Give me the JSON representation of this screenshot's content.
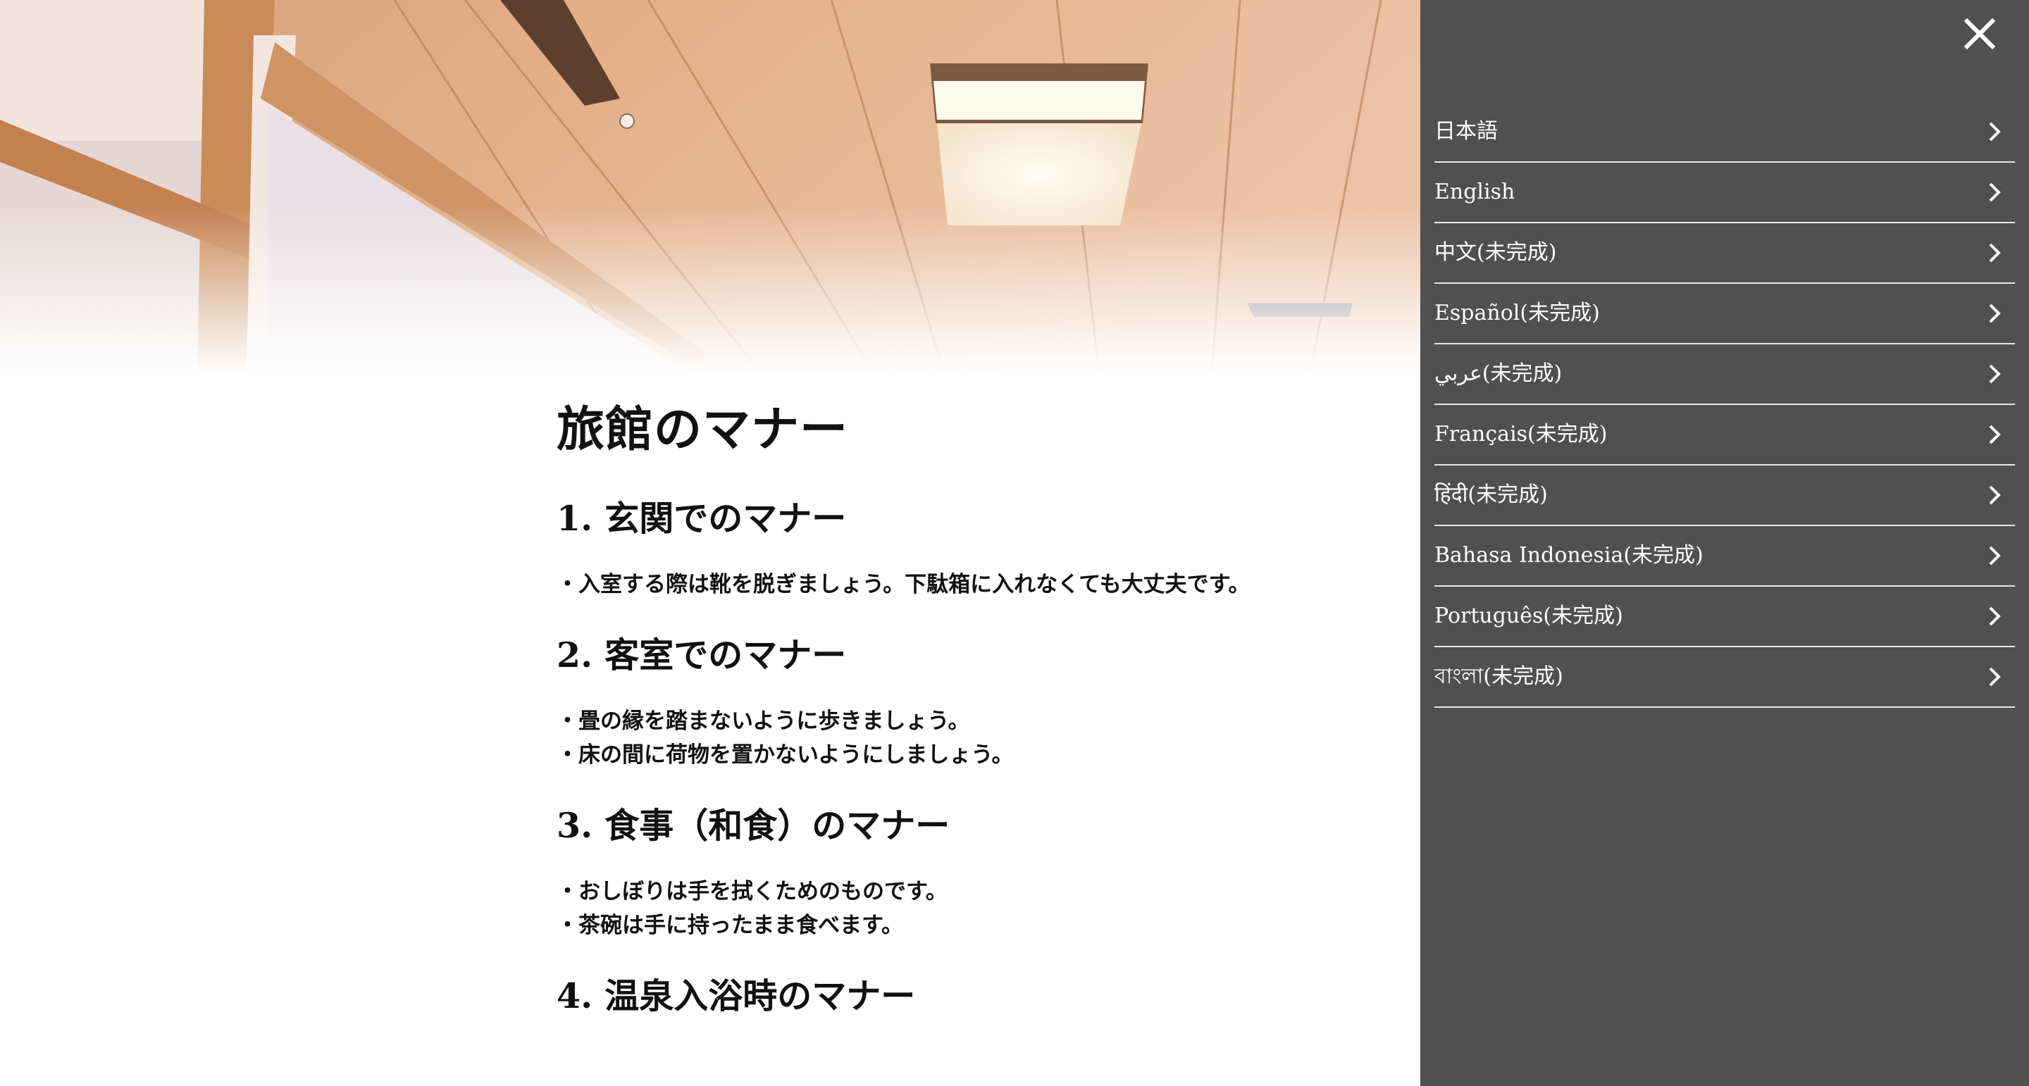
{
  "article": {
    "title": "旅館のマナー",
    "sections": [
      {
        "heading": "1. 玄関でのマナー",
        "items": [
          "・入室する際は靴を脱ぎましょう。下駄箱に入れなくても大丈夫です。"
        ]
      },
      {
        "heading": "2. 客室でのマナー",
        "items": [
          "・畳の縁を踏まないように歩きましょう。",
          "・床の間に荷物を置かないようにしましょう。"
        ]
      },
      {
        "heading": "3. 食事（和食）のマナー",
        "items": [
          "・おしぼりは手を拭くためのものです。",
          "・茶碗は手に持ったまま食べます。"
        ]
      },
      {
        "heading": "4. 温泉入浴時のマナー",
        "items": []
      }
    ]
  },
  "drawer": {
    "close_icon": "close-icon",
    "chevron_icon": "chevron-right-icon",
    "background_color": "#505050",
    "languages": [
      {
        "label": "日本語"
      },
      {
        "label": "English"
      },
      {
        "label": "中文(未完成)"
      },
      {
        "label": "Español(未完成)"
      },
      {
        "label": "عربي(未完成)"
      },
      {
        "label": "Français(未完成)"
      },
      {
        "label": "हिंदी(未完成)"
      },
      {
        "label": "Bahasa Indonesia(未完成)"
      },
      {
        "label": "Português(未完成)"
      },
      {
        "label": "বাংলা(未完成)"
      }
    ]
  }
}
